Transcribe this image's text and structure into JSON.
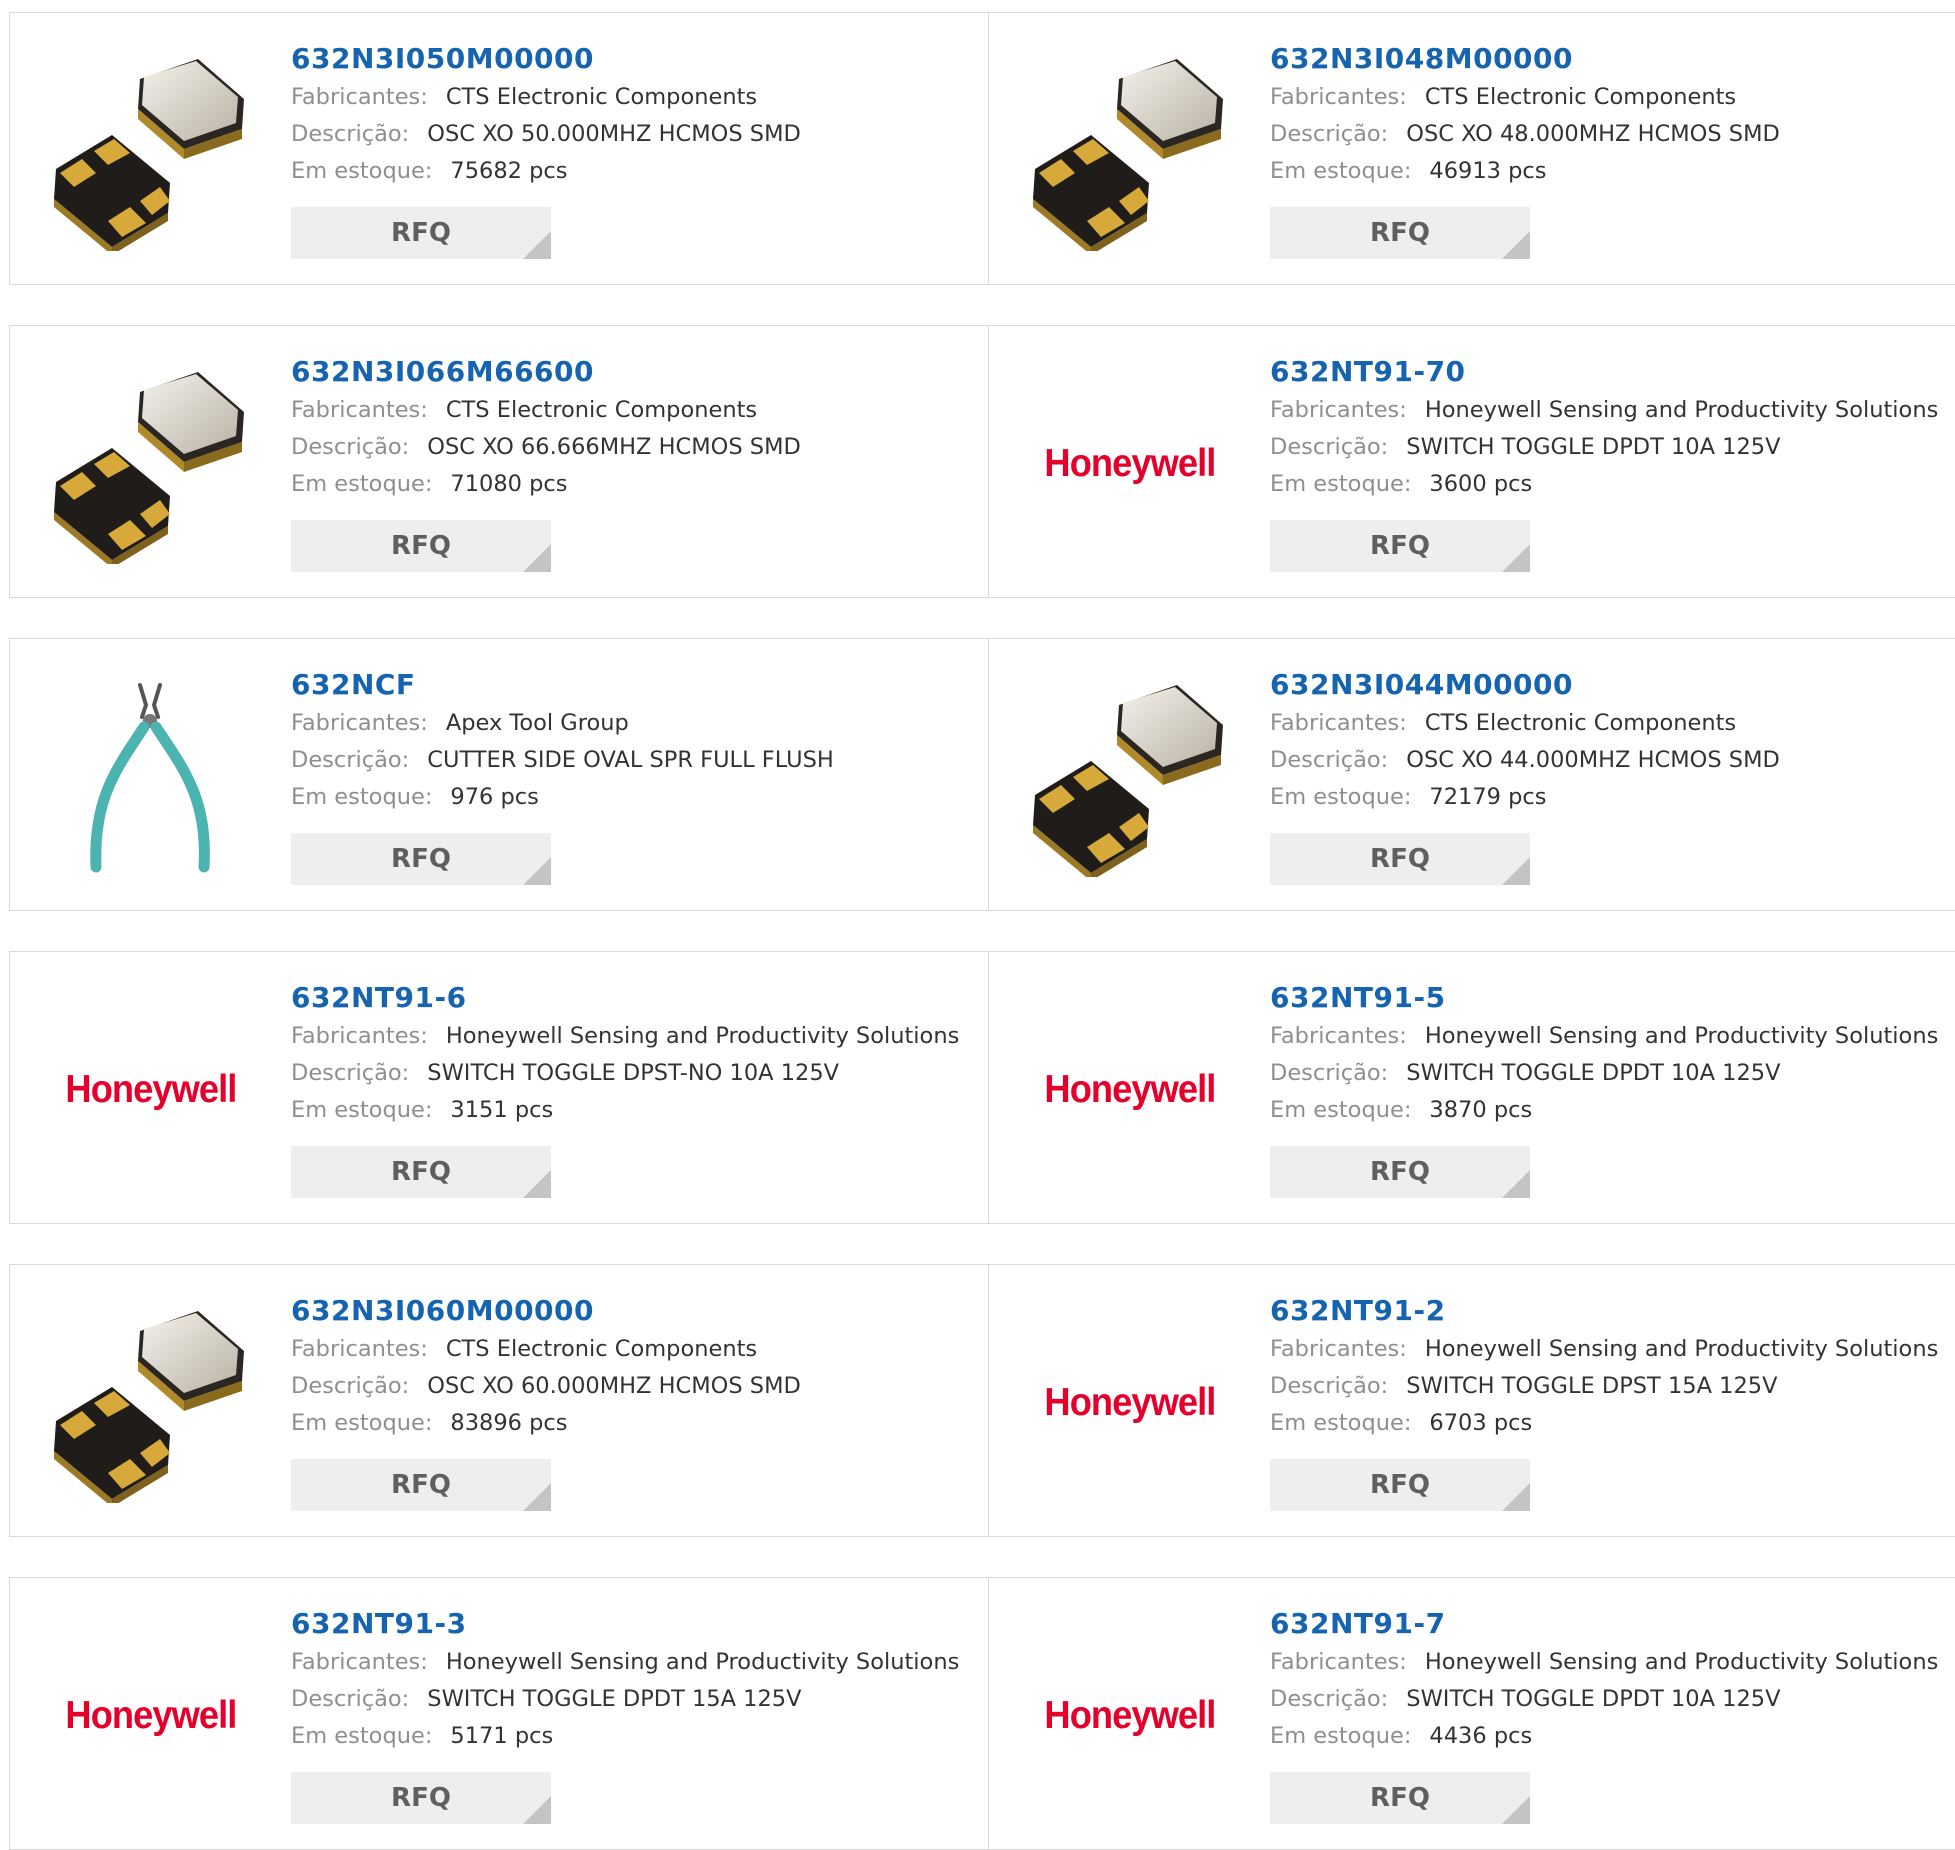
{
  "labels": {
    "manufacturer": "Fabricantes:",
    "description": "Descrição:",
    "stock": "Em estoque:",
    "rfq": "RFQ"
  },
  "colors": {
    "part_link": "#1664b0",
    "honeywell_red": "#e4002b",
    "label_gray": "#8f8f8f",
    "rfq_bg": "#eeeeee"
  },
  "products": [
    {
      "part": "632N3I050M00000",
      "manufacturer": "CTS Electronic Components",
      "description": "OSC XO 50.000MHZ HCMOS SMD",
      "stock": "75682 pcs",
      "image": "oscillator-icon"
    },
    {
      "part": "632N3I048M00000",
      "manufacturer": "CTS Electronic Components",
      "description": "OSC XO 48.000MHZ HCMOS SMD",
      "stock": "46913 pcs",
      "image": "oscillator-icon"
    },
    {
      "part": "632N3I066M66600",
      "manufacturer": "CTS Electronic Components",
      "description": "OSC XO 66.666MHZ HCMOS SMD",
      "stock": "71080 pcs",
      "image": "oscillator-icon"
    },
    {
      "part": "632NT91-70",
      "manufacturer": "Honeywell Sensing and Productivity Solutions",
      "description": "SWITCH TOGGLE DPDT 10A 125V",
      "stock": "3600 pcs",
      "image": "honeywell-logo",
      "logo_text": "Honeywell"
    },
    {
      "part": "632NCF",
      "manufacturer": "Apex Tool Group",
      "description": "CUTTER SIDE OVAL SPR FULL FLUSH",
      "stock": "976 pcs",
      "image": "cutter-icon"
    },
    {
      "part": "632N3I044M00000",
      "manufacturer": "CTS Electronic Components",
      "description": "OSC XO 44.000MHZ HCMOS SMD",
      "stock": "72179 pcs",
      "image": "oscillator-icon"
    },
    {
      "part": "632NT91-6",
      "manufacturer": "Honeywell Sensing and Productivity Solutions",
      "description": "SWITCH TOGGLE DPST-NO 10A 125V",
      "stock": "3151 pcs",
      "image": "honeywell-logo",
      "logo_text": "Honeywell"
    },
    {
      "part": "632NT91-5",
      "manufacturer": "Honeywell Sensing and Productivity Solutions",
      "description": "SWITCH TOGGLE DPDT 10A 125V",
      "stock": "3870 pcs",
      "image": "honeywell-logo",
      "logo_text": "Honeywell"
    },
    {
      "part": "632N3I060M00000",
      "manufacturer": "CTS Electronic Components",
      "description": "OSC XO 60.000MHZ HCMOS SMD",
      "stock": "83896 pcs",
      "image": "oscillator-icon"
    },
    {
      "part": "632NT91-2",
      "manufacturer": "Honeywell Sensing and Productivity Solutions",
      "description": "SWITCH TOGGLE DPST 15A 125V",
      "stock": "6703 pcs",
      "image": "honeywell-logo",
      "logo_text": "Honeywell"
    },
    {
      "part": "632NT91-3",
      "manufacturer": "Honeywell Sensing and Productivity Solutions",
      "description": "SWITCH TOGGLE DPDT 15A 125V",
      "stock": "5171 pcs",
      "image": "honeywell-logo",
      "logo_text": "Honeywell"
    },
    {
      "part": "632NT91-7",
      "manufacturer": "Honeywell Sensing and Productivity Solutions",
      "description": "SWITCH TOGGLE DPDT 10A 125V",
      "stock": "4436 pcs",
      "image": "honeywell-logo",
      "logo_text": "Honeywell"
    }
  ]
}
